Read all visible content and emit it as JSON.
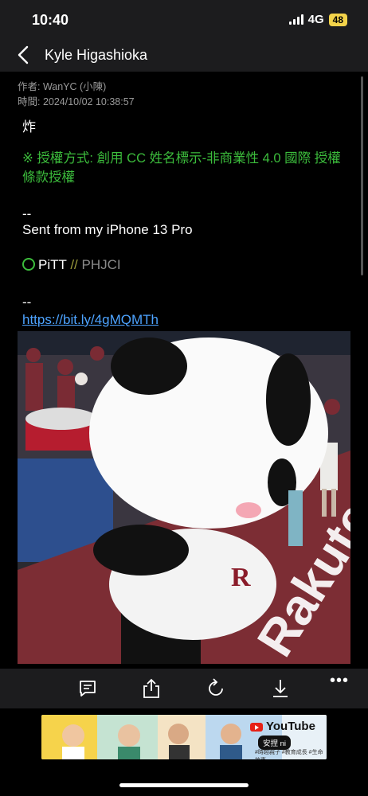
{
  "status": {
    "time": "10:40",
    "network": "4G",
    "battery": "48"
  },
  "nav": {
    "title": "Kyle Higashioka"
  },
  "post": {
    "author_line": "作者: WanYC (小陳)",
    "time_line": "時間: 2024/10/02 10:38:57",
    "body": "炸",
    "license": "※ 授權方式: 創用 CC 姓名標示-非商業性 4.0 國際 授權條款授權",
    "sep1": "--",
    "sent_from": "Sent from my iPhone 13 Pro",
    "pitt_label": "PiTT",
    "pitt_slashes": "//",
    "pitt_user": "PHJCI",
    "sep2": "--",
    "url": "https://bit.ly/4gMQMTh"
  },
  "toolbar": {
    "icons": [
      "comment-icon",
      "share-icon",
      "refresh-icon",
      "download-icon",
      "more-icon"
    ],
    "more_label": "•••"
  },
  "banner": {
    "youtube_label": "YouTube",
    "channel_label": "安捏 ni",
    "tagline": "#時越親子 #教育成長 #生命故事"
  },
  "colors": {
    "accent_green": "#3cbd3c",
    "link_blue": "#4da3ff",
    "bar_bg": "#1c1c1e"
  }
}
